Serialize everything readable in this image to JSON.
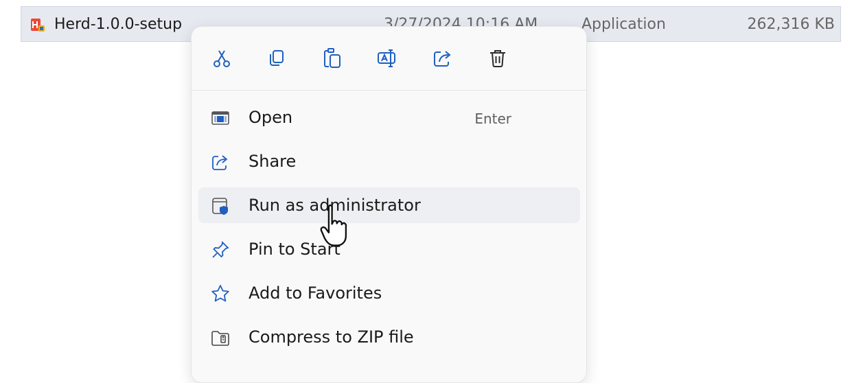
{
  "file": {
    "name": "Herd-1.0.0-setup",
    "date_modified": "3/27/2024 10:16 AM",
    "type": "Application",
    "size": "262,316 KB",
    "icon": "herd-app-icon"
  },
  "context_menu": {
    "quick_actions": [
      {
        "name": "cut",
        "icon": "scissors-icon"
      },
      {
        "name": "copy",
        "icon": "copy-icon"
      },
      {
        "name": "paste",
        "icon": "paste-icon"
      },
      {
        "name": "rename",
        "icon": "rename-icon"
      },
      {
        "name": "share",
        "icon": "share-icon"
      },
      {
        "name": "delete",
        "icon": "trash-icon"
      }
    ],
    "items": [
      {
        "label": "Open",
        "shortcut": "Enter",
        "icon": "open-icon"
      },
      {
        "label": "Share",
        "icon": "share-icon"
      },
      {
        "label": "Run as administrator",
        "icon": "shield-window-icon",
        "hovered": true
      },
      {
        "label": "Pin to Start",
        "icon": "pin-icon"
      },
      {
        "label": "Add to Favorites",
        "icon": "star-icon"
      },
      {
        "label": "Compress to ZIP file",
        "icon": "zip-folder-icon"
      }
    ]
  },
  "colors": {
    "accent": "#1f5fbf",
    "selection": "#e6eaf0",
    "menu_bg": "#f9f9fa",
    "hover": "#eeeff2"
  }
}
